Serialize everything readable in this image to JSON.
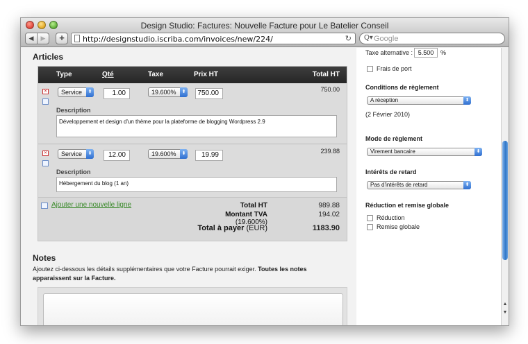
{
  "window": {
    "title": "Design Studio: Factures: Nouvelle Facture pour Le Batelier Conseil"
  },
  "toolbar": {
    "back_icon": "◀",
    "forward_icon": "▶",
    "add_icon": "+",
    "url": "http://designstudio.iscriba.com/invoices/new/224/",
    "reload_icon": "↻",
    "search_placeholder": "Google",
    "search_icon": "Q▾"
  },
  "articles": {
    "heading": "Articles",
    "columns": {
      "type": "Type",
      "qty": "Qté",
      "tax": "Taxe",
      "price": "Prix HT",
      "total": "Total HT"
    },
    "rows": [
      {
        "type": "Service",
        "qty": "1.00",
        "tax": "19.600%",
        "price": "750.00",
        "total": "750.00",
        "description_label": "Description",
        "description": "Développement et design d'un thème pour la plateforme de blogging Wordpress 2.9"
      },
      {
        "type": "Service",
        "qty": "12.00",
        "tax": "19.600%",
        "price": "19.99",
        "total": "239.88",
        "description_label": "Description",
        "description": "Hébergement du blog (1 an)"
      }
    ],
    "add_line": "Ajouter une nouvelle ligne",
    "totals": {
      "total_ht_label": "Total HT",
      "total_ht_value": "989.88",
      "tva_label": "Montant TVA",
      "tva_rate": "(19.600%)",
      "tva_value": "194.02",
      "pay_label": "Total à payer",
      "pay_currency": "(EUR)",
      "pay_value": "1183.90"
    }
  },
  "notes": {
    "heading": "Notes",
    "text_plain": "Ajoutez ci-dessous les détails supplémentaires que votre Facture pourrait exiger. ",
    "text_bold": "Toutes les notes apparaissent sur la Facture."
  },
  "sidebar": {
    "alt_tax_label": "Taxe alternative :",
    "alt_tax_value": "5.500",
    "alt_tax_unit": "%",
    "shipping_label": "Frais de port",
    "conditions_heading": "Conditions de règlement",
    "conditions_value": "A réception",
    "conditions_date": "(2 Février 2010)",
    "mode_heading": "Mode de règlement",
    "mode_value": "Virement bancaire",
    "interest_heading": "Intérêts de retard",
    "interest_value": "Pas d'intérêts de retard",
    "discount_heading": "Réduction et remise globale",
    "discount_label": "Réduction",
    "global_discount_label": "Remise globale"
  },
  "icons": {
    "arrow": "⬍",
    "delete": "✕"
  }
}
